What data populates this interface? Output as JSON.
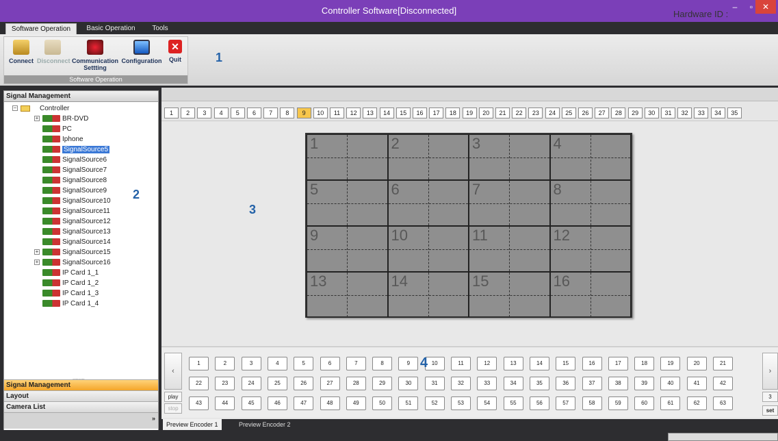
{
  "window": {
    "title": "Controller Software[Disconnected]"
  },
  "menu": {
    "tabs": [
      "Software Operation",
      "Basic Operation",
      "Tools"
    ]
  },
  "ribbon": {
    "buttons": [
      {
        "label": "Connect",
        "icon": "connect-icon",
        "enabled": true
      },
      {
        "label": "Disconnect",
        "icon": "disconnect-icon",
        "enabled": false
      },
      {
        "label": "Communication Settting",
        "icon": "communication-settings-icon",
        "enabled": true
      },
      {
        "label": "Configuration",
        "icon": "monitor-icon",
        "enabled": true
      },
      {
        "label": "Quit",
        "icon": "close-icon",
        "enabled": true
      }
    ],
    "group_label": "Software Operation",
    "hardware_id_label": "Hardware ID :"
  },
  "callouts": [
    "1",
    "2",
    "3",
    "4"
  ],
  "signal_panel": {
    "title": "Signal Management",
    "tree_root": "Controller",
    "items": [
      "BR-DVD",
      "PC",
      "Iphone",
      "SignalSource5",
      "SignalSource6",
      "SignalSource7",
      "SignalSource8",
      "SignalSource9",
      "SignalSource10",
      "SignalSource11",
      "SignalSource12",
      "SignalSource13",
      "SignalSource14",
      "SignalSource15",
      "SignalSource16",
      "IP Card 1_1",
      "IP Card 1_2",
      "IP Card 1_3",
      "IP Card 1_4"
    ],
    "selected": "SignalSource5",
    "bottom_tabs": [
      "Signal Management",
      "Layout",
      "Camera List"
    ]
  },
  "scene_tabs": {
    "labels": [
      "1",
      "2",
      "3",
      "4",
      "5",
      "6",
      "7",
      "8",
      "9",
      "10",
      "11",
      "12",
      "13",
      "14",
      "15",
      "16",
      "17",
      "18",
      "19",
      "20",
      "21",
      "22",
      "23",
      "24",
      "25",
      "26",
      "27",
      "28",
      "29",
      "30",
      "31",
      "32",
      "33",
      "34",
      "35"
    ],
    "active": "9"
  },
  "video_wall": {
    "cells": [
      "1",
      "2",
      "3",
      "4",
      "5",
      "6",
      "7",
      "8",
      "9",
      "10",
      "11",
      "12",
      "13",
      "14",
      "15",
      "16"
    ]
  },
  "encoder": {
    "buttons": [
      "1",
      "2",
      "3",
      "4",
      "5",
      "6",
      "7",
      "8",
      "9",
      "10",
      "11",
      "12",
      "13",
      "14",
      "15",
      "16",
      "17",
      "18",
      "19",
      "20",
      "21",
      "22",
      "23",
      "24",
      "25",
      "26",
      "27",
      "28",
      "29",
      "30",
      "31",
      "32",
      "33",
      "34",
      "35",
      "36",
      "37",
      "38",
      "39",
      "40",
      "41",
      "42",
      "43",
      "44",
      "45",
      "46",
      "47",
      "48",
      "49",
      "50",
      "51",
      "52",
      "53",
      "54",
      "55",
      "56",
      "57",
      "58",
      "59",
      "60",
      "61",
      "62",
      "63"
    ],
    "play": "play",
    "stop": "stop",
    "set": "set",
    "spin_value": "3",
    "prev": "‹",
    "next": "›"
  },
  "bottom_tabs": [
    "Preview Encoder 1",
    "Preview Encoder 2"
  ],
  "colors": {
    "titlebar": "#7b3fb8",
    "active_tab": "#f7c64b",
    "selection": "#3a78d6",
    "callout": "#2462a8"
  }
}
